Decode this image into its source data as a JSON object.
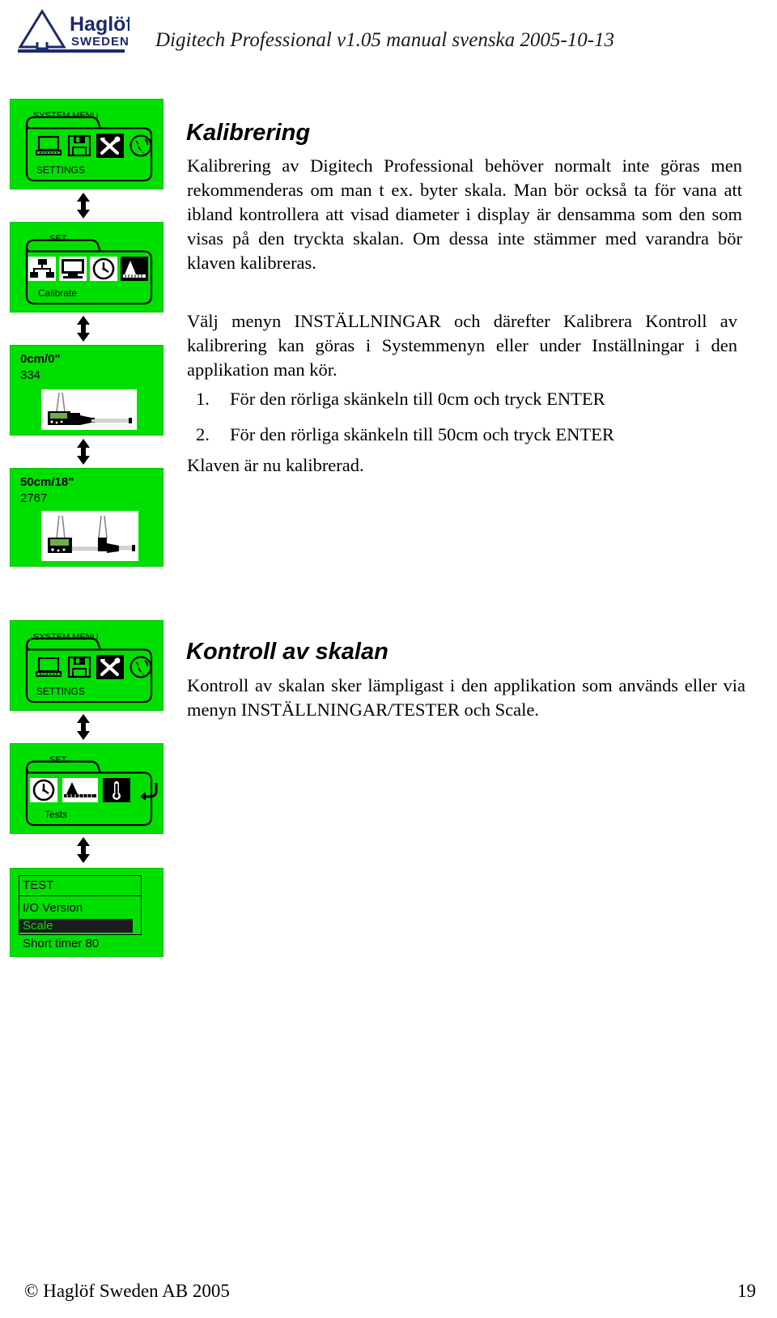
{
  "header": {
    "logo_name": "Haglöf",
    "logo_sub": "SWEDEN",
    "doc_title": "Digitech Professional v1.05 manual svenska 2005-10-13"
  },
  "colors": {
    "lcd_green": "#00e000",
    "logo_navy": "#1b2a6b",
    "highlight_bg": "#1c1c1c"
  },
  "screens": {
    "system_menu_1": {
      "title": "SYSTEM MENU",
      "label": "SETTINGS",
      "icons": [
        "laptop-icon",
        "floppy-disk-icon",
        "tools-icon",
        "globe-icon"
      ],
      "selected_icon": "tools-icon"
    },
    "set_calibrate": {
      "title": "SET",
      "label": "Calibrate",
      "icons": [
        "network-icon",
        "monitor-icon",
        "clock-icon",
        "scale-ramp-icon"
      ],
      "selected_icon": "scale-ramp-icon"
    },
    "cal_zero": {
      "value": "0cm/0\"",
      "count": "334",
      "image": "caliper-closed-illustration"
    },
    "cal_fifty": {
      "value": "50cm/18\"",
      "count": "2767",
      "image": "caliper-open-illustration"
    },
    "system_menu_2": {
      "title": "SYSTEM MENU",
      "label": "SETTINGS",
      "icons": [
        "laptop-icon",
        "floppy-disk-icon",
        "tools-icon",
        "globe-icon"
      ],
      "selected_icon": "tools-icon"
    },
    "set_tests": {
      "title": "SET",
      "label": "Tests",
      "icons": [
        "clock-icon",
        "scale-ramp-icon",
        "thermometer-icon",
        "back-arrow-icon"
      ],
      "selected_icon": "thermometer-icon"
    },
    "test_list": {
      "title": "TEST",
      "items": [
        "I/O Version",
        "Scale",
        "Short timer 80"
      ],
      "selected_item": "Scale"
    }
  },
  "content": {
    "section1": {
      "heading": "Kalibrering",
      "paragraph1": "Kalibrering av Digitech Professional behöver normalt inte göras men rekommenderas om man t ex. byter skala. Man bör också ta för vana att ibland kontrollera att visad diameter i display är densamma som den som visas på den tryckta skalan. Om dessa inte stämmer med varandra bör klaven kalibreras.",
      "paragraph2": "Välj menyn INSTÄLLNINGAR och därefter Kalibrera Kontroll av kalibrering kan göras i Systemmenyn eller under Inställningar i den applikation man kör.",
      "steps": [
        {
          "num": "1.",
          "text": "För den rörliga skänkeln till 0cm och tryck ENTER"
        },
        {
          "num": "2.",
          "text": "För den rörliga skänkeln till 50cm och tryck ENTER"
        }
      ],
      "paragraph3": "Klaven är nu kalibrerad."
    },
    "section2": {
      "heading": "Kontroll av skalan",
      "paragraph1": "Kontroll av skalan sker lämpligast i den applikation som används eller via menyn INSTÄLLNINGAR/TESTER och Scale."
    }
  },
  "footer": {
    "copyright": "© Haglöf Sweden AB 2005",
    "page": "19"
  }
}
